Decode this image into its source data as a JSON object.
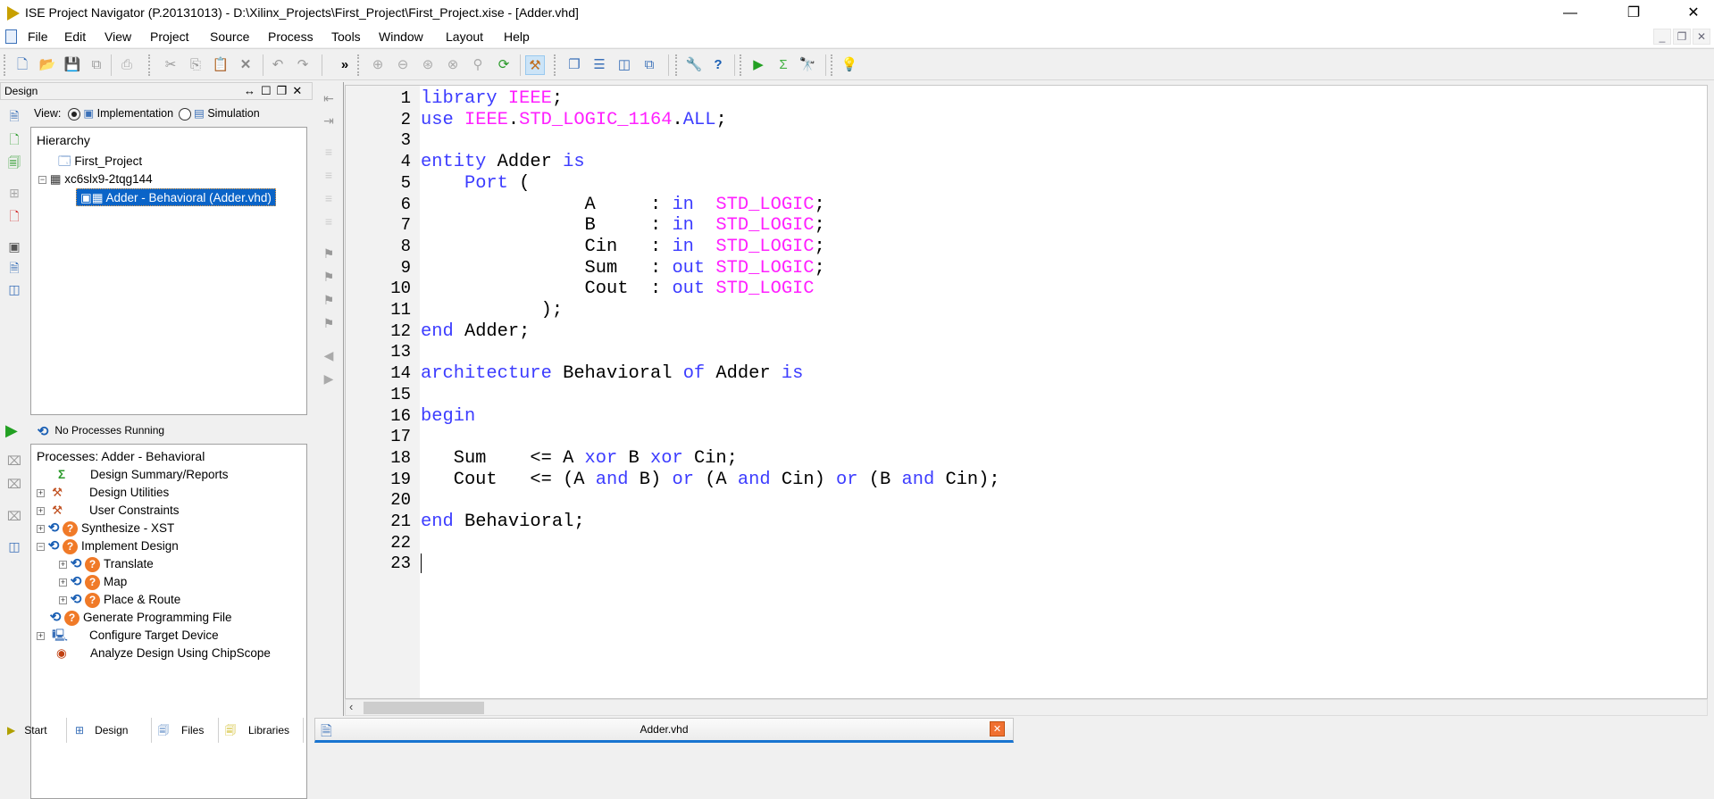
{
  "window": {
    "title": "ISE Project Navigator (P.20131013) - D:\\Xilinx_Projects\\First_Project\\First_Project.xise - [Adder.vhd]",
    "minimize": "—",
    "maximize": "❐",
    "close": "✕"
  },
  "menu": [
    "File",
    "Edit",
    "View",
    "Project",
    "Source",
    "Process",
    "Tools",
    "Window",
    "Layout",
    "Help"
  ],
  "mdi": {
    "minimize": "_",
    "restore": "❐",
    "close": "✕"
  },
  "toolbar": {
    "overflow": "»"
  },
  "design_panel": {
    "title": "Design",
    "controls": [
      "↔",
      "☐",
      "❐",
      "✕"
    ],
    "view_label": "View:",
    "view_options": [
      "Implementation",
      "Simulation"
    ],
    "view_selected": "Implementation",
    "hierarchy_title": "Hierarchy",
    "hierarchy": [
      "First_Project",
      "xc6slx9-2tqg144",
      "Adder - Behavioral (Adder.vhd)"
    ]
  },
  "process_status": "No Processes Running",
  "processes": {
    "title": "Processes: Adder - Behavioral",
    "items": [
      "Design Summary/Reports",
      "Design Utilities",
      "User Constraints",
      "Synthesize - XST",
      "Implement Design",
      "Translate",
      "Map",
      "Place & Route",
      "Generate Programming File",
      "Configure Target Device",
      "Analyze Design Using ChipScope"
    ]
  },
  "bottom_tabs": [
    "Start",
    "Design",
    "Files",
    "Libraries"
  ],
  "editor": {
    "tab": "Adder.vhd",
    "lines": [
      [
        [
          "kw",
          "library"
        ],
        [
          "pl",
          " "
        ],
        [
          "ty",
          "IEEE"
        ],
        [
          "pl",
          ";"
        ]
      ],
      [
        [
          "kw",
          "use"
        ],
        [
          "pl",
          " "
        ],
        [
          "ty",
          "IEEE"
        ],
        [
          "pl",
          "."
        ],
        [
          "ty",
          "STD_LOGIC_1164"
        ],
        [
          "pl",
          "."
        ],
        [
          "kw",
          "ALL"
        ],
        [
          "pl",
          ";"
        ]
      ],
      [],
      [
        [
          "kw",
          "entity"
        ],
        [
          "pl",
          " Adder "
        ],
        [
          "kw",
          "is"
        ]
      ],
      [
        [
          "pl",
          "    "
        ],
        [
          "kw",
          "Port"
        ],
        [
          "pl",
          " ("
        ]
      ],
      [
        [
          "pl",
          "               A     : "
        ],
        [
          "kw",
          "in"
        ],
        [
          "pl",
          "  "
        ],
        [
          "ty",
          "STD_LOGIC"
        ],
        [
          "pl",
          ";"
        ]
      ],
      [
        [
          "pl",
          "               B     : "
        ],
        [
          "kw",
          "in"
        ],
        [
          "pl",
          "  "
        ],
        [
          "ty",
          "STD_LOGIC"
        ],
        [
          "pl",
          ";"
        ]
      ],
      [
        [
          "pl",
          "               Cin   : "
        ],
        [
          "kw",
          "in"
        ],
        [
          "pl",
          "  "
        ],
        [
          "ty",
          "STD_LOGIC"
        ],
        [
          "pl",
          ";"
        ]
      ],
      [
        [
          "pl",
          "               Sum   : "
        ],
        [
          "kw",
          "out"
        ],
        [
          "pl",
          " "
        ],
        [
          "ty",
          "STD_LOGIC"
        ],
        [
          "pl",
          ";"
        ]
      ],
      [
        [
          "pl",
          "               Cout  : "
        ],
        [
          "kw",
          "out"
        ],
        [
          "pl",
          " "
        ],
        [
          "ty",
          "STD_LOGIC"
        ]
      ],
      [
        [
          "pl",
          "           );"
        ]
      ],
      [
        [
          "kw",
          "end"
        ],
        [
          "pl",
          " Adder;"
        ]
      ],
      [],
      [
        [
          "kw",
          "architecture"
        ],
        [
          "pl",
          " Behavioral "
        ],
        [
          "kw",
          "of"
        ],
        [
          "pl",
          " Adder "
        ],
        [
          "kw",
          "is"
        ]
      ],
      [],
      [
        [
          "kw",
          "begin"
        ]
      ],
      [],
      [
        [
          "pl",
          "   Sum    <= A "
        ],
        [
          "kw",
          "xor"
        ],
        [
          "pl",
          " B "
        ],
        [
          "kw",
          "xor"
        ],
        [
          "pl",
          " Cin;"
        ]
      ],
      [
        [
          "pl",
          "   Cout   <= (A "
        ],
        [
          "kw",
          "and"
        ],
        [
          "pl",
          " B) "
        ],
        [
          "kw",
          "or"
        ],
        [
          "pl",
          " (A "
        ],
        [
          "kw",
          "and"
        ],
        [
          "pl",
          " Cin) "
        ],
        [
          "kw",
          "or"
        ],
        [
          "pl",
          " (B "
        ],
        [
          "kw",
          "and"
        ],
        [
          "pl",
          " Cin);"
        ]
      ],
      [],
      [
        [
          "kw",
          "end"
        ],
        [
          "pl",
          " Behavioral;"
        ]
      ],
      [],
      []
    ]
  }
}
